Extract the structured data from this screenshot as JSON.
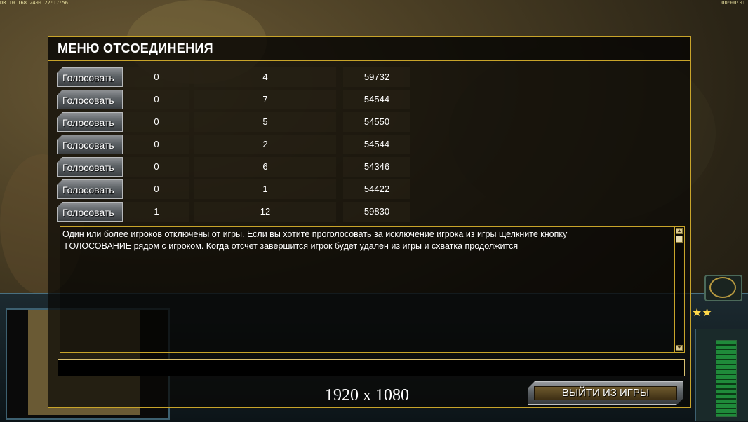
{
  "hud": {
    "top_left": "DR 10 168 2400 22:17:56",
    "top_right": "00:00:01"
  },
  "dialog": {
    "title": "МЕНЮ ОТСОЕДИНЕНИЯ",
    "vote_label": "Голосовать",
    "rows": [
      {
        "a": "0",
        "b": "4",
        "c": "59732"
      },
      {
        "a": "0",
        "b": "7",
        "c": "54544"
      },
      {
        "a": "0",
        "b": "5",
        "c": "54550"
      },
      {
        "a": "0",
        "b": "2",
        "c": "54544"
      },
      {
        "a": "0",
        "b": "6",
        "c": "54346"
      },
      {
        "a": "0",
        "b": "1",
        "c": "54422"
      },
      {
        "a": "1",
        "b": "12",
        "c": "59830"
      }
    ],
    "message": "Один или более игроков отключены от игры. Если вы хотите проголосовать за исключение игрока из игры щелкните кнопку\n ГОЛОСОВАНИЕ рядом с игроком. Когда отсчет завершится игрок будет удален из игры и схватка продолжится",
    "chat_value": "",
    "exit_label": "ВЫЙТИ ИЗ ИГРЫ"
  },
  "overlay": {
    "resolution": "1920 x 1080"
  },
  "colors": {
    "gold_border": "#c8a42a",
    "text": "#ffffff"
  }
}
